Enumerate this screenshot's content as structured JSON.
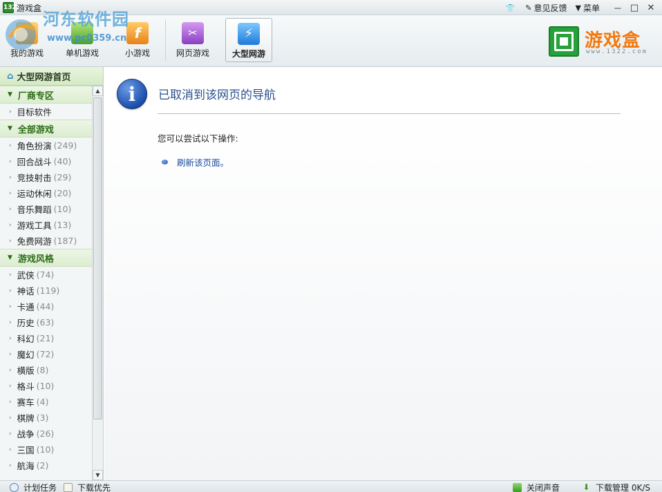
{
  "window": {
    "title": "游戏盒",
    "app_icon_text": "1322",
    "watermark_text": "河东软件园",
    "watermark_url": "www.pc0359.cn",
    "feedback_label": "意见反馈",
    "menu_label": "菜单",
    "minimize_glyph": "－",
    "maximize_glyph": "□",
    "close_glyph": "✕"
  },
  "toolbar": {
    "tabs": [
      {
        "label": "我的游戏"
      },
      {
        "label": "单机游戏"
      },
      {
        "label": "小游戏"
      },
      {
        "label": "网页游戏"
      },
      {
        "label": "大型网游",
        "active": true
      }
    ],
    "brand_name": "游戏盒",
    "brand_url": "www.1322.com"
  },
  "sidebar": {
    "home_label": "大型网游首页",
    "sections": [
      {
        "title": "厂商专区",
        "items": [
          {
            "name": "目标软件",
            "count": ""
          }
        ]
      },
      {
        "title": "全部游戏",
        "items": [
          {
            "name": "角色扮演",
            "count": "(249)"
          },
          {
            "name": "回合战斗",
            "count": "(40)"
          },
          {
            "name": "竞技射击",
            "count": "(29)"
          },
          {
            "name": "运动休闲",
            "count": "(20)"
          },
          {
            "name": "音乐舞蹈",
            "count": "(10)"
          },
          {
            "name": "游戏工具",
            "count": "(13)"
          },
          {
            "name": "免费网游",
            "count": "(187)"
          }
        ]
      },
      {
        "title": "游戏风格",
        "items": [
          {
            "name": "武侠",
            "count": "(74)"
          },
          {
            "name": "神话",
            "count": "(119)"
          },
          {
            "name": "卡通",
            "count": "(44)"
          },
          {
            "name": "历史",
            "count": "(63)"
          },
          {
            "name": "科幻",
            "count": "(21)"
          },
          {
            "name": "魔幻",
            "count": "(72)"
          },
          {
            "name": "横版",
            "count": "(8)"
          },
          {
            "name": "格斗",
            "count": "(10)"
          },
          {
            "name": "赛车",
            "count": "(4)"
          },
          {
            "name": "棋牌",
            "count": "(3)"
          },
          {
            "name": "战争",
            "count": "(26)"
          },
          {
            "name": "三国",
            "count": "(10)"
          },
          {
            "name": "航海",
            "count": "(2)"
          }
        ]
      }
    ]
  },
  "main": {
    "info_glyph": "i",
    "title": "已取消到该网页的导航",
    "subtitle": "您可以尝试以下操作:",
    "action_link": "刷新该页面。"
  },
  "statusbar": {
    "schedule_label": "计划任务",
    "priority_label": "下载优先",
    "mute_label": "关闭声音",
    "download_label": "下载管理 0K/S"
  },
  "colors": {
    "accent_green": "#2b6c16",
    "brand_orange": "#f07a12",
    "link_blue": "#1a4aa0"
  }
}
